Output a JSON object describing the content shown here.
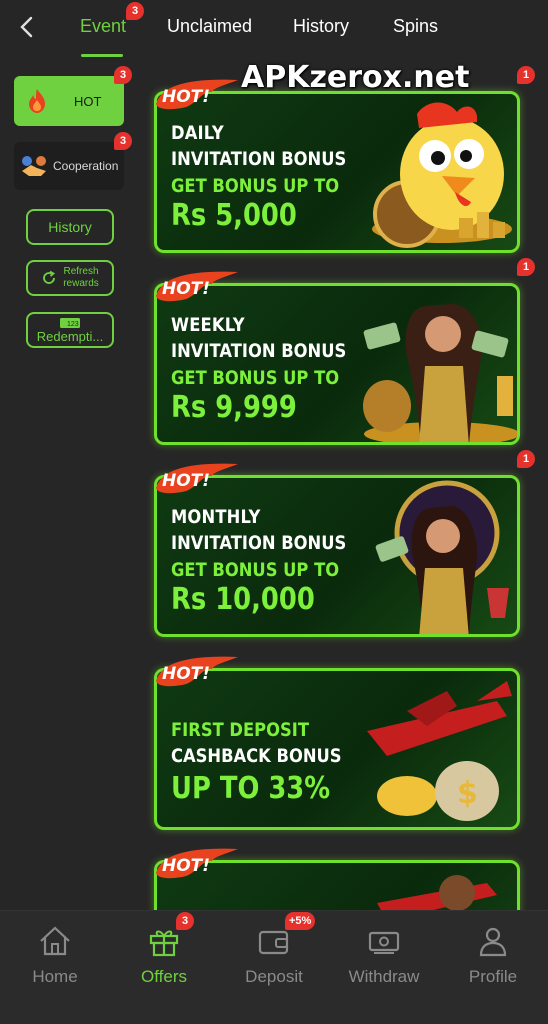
{
  "tabs": [
    {
      "label": "Event",
      "active": true,
      "badge": "3"
    },
    {
      "label": "Unclaimed"
    },
    {
      "label": "History"
    },
    {
      "label": "Spins"
    }
  ],
  "sidebar": {
    "hot": {
      "label": "HOT",
      "badge": "3"
    },
    "cooperation": {
      "label": "Cooperation",
      "badge": "3"
    },
    "history_label": "History",
    "refresh_label_line1": "Refresh",
    "refresh_label_line2": "rewards",
    "redemption_label": "Redempti...",
    "redemption_icon_text": "123"
  },
  "watermark": "APKzerox.net",
  "banners": [
    {
      "tag": "HOT!",
      "badge": "1",
      "line1": "DAILY",
      "line2": "INVITATION BONUS",
      "line3": "GET BONUS UP TO",
      "line4": "Rs 5,000"
    },
    {
      "tag": "HOT!",
      "badge": "1",
      "line1": "WEEKLY",
      "line2": "INVITATION BONUS",
      "line3": "GET BONUS UP TO",
      "line4": "Rs 9,999"
    },
    {
      "tag": "HOT!",
      "badge": "1",
      "line1": "MONTHLY",
      "line2": "INVITATION BONUS",
      "line3": "GET BONUS UP TO",
      "line4": "Rs 10,000"
    },
    {
      "tag": "HOT!",
      "line1": "FIRST DEPOSIT",
      "line2": "CASHBACK BONUS",
      "line3": "",
      "line4": "UP TO 33%"
    },
    {
      "tag": "HOT!"
    }
  ],
  "bottom_nav": [
    {
      "label": "Home",
      "icon": "home-icon"
    },
    {
      "label": "Offers",
      "icon": "gift-icon",
      "active": true,
      "badge": "3"
    },
    {
      "label": "Deposit",
      "icon": "wallet-icon",
      "badge": "+5%"
    },
    {
      "label": "Withdraw",
      "icon": "cash-icon"
    },
    {
      "label": "Profile",
      "icon": "user-icon"
    }
  ],
  "colors": {
    "accent": "#6fd13f",
    "badge": "#e5322d",
    "background": "#262626"
  }
}
